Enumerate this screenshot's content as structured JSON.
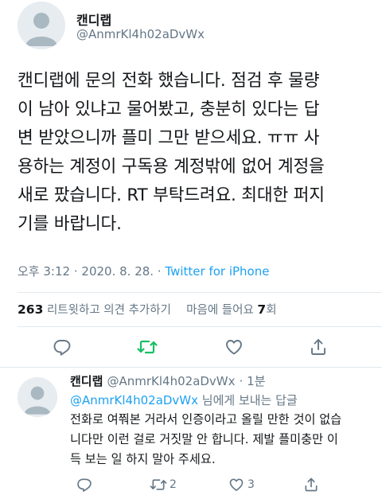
{
  "main_tweet": {
    "display_name": "캔디랩",
    "handle": "@AnmrKl4h02aDvWx",
    "text_lines": [
      "캔디랩에 문의 전화 했습니다. 점검 후 물량",
      "이 남아 있냐고 물어봤고, 충분히 있다는 답",
      "변 받았으니까 플미 그만 받으세요. ㅠㅠ 사",
      "용하는 계정이 구독용 계정밖에 없어 계정을",
      "새로 팠습니다. RT 부탁드려요. 최대한 퍼지",
      "기를 바랍니다."
    ],
    "time": "오후 3:12",
    "separator": "·",
    "date": "2020. 8. 28.",
    "source": "Twitter for iPhone",
    "retweet_count": "263",
    "retweet_label": "리트윗하고 의견 추가하기",
    "like_label": "마음에 들어요",
    "like_count": "7",
    "like_suffix": "회"
  },
  "reply": {
    "display_name": "캔디랩",
    "handle": "@AnmrKl4h02aDvWx",
    "time_ago": "· 1분",
    "replying_to": "@AnmrKl4h02aDvWx",
    "replying_suffix": " 님에게 보내는 답글",
    "text_lines": [
      "전화로 여쭤본 거라서 인증이라고 올릴 만한 것이 없습",
      "니다만 이런 걸로 거짓말 안 합니다. 제발 플미충만 이",
      "득 보는 일 하지 말아 주세요."
    ],
    "retweet_count": "2",
    "like_count": "3"
  },
  "colors": {
    "accent": "#1da1f2",
    "retweet_green": "#17bf63",
    "muted": "#657786",
    "divider": "#e1e8ed"
  },
  "icons": {
    "avatar": "default-avatar-icon",
    "reply": "reply-icon",
    "retweet": "retweet-icon",
    "like": "heart-icon",
    "share": "share-icon"
  }
}
